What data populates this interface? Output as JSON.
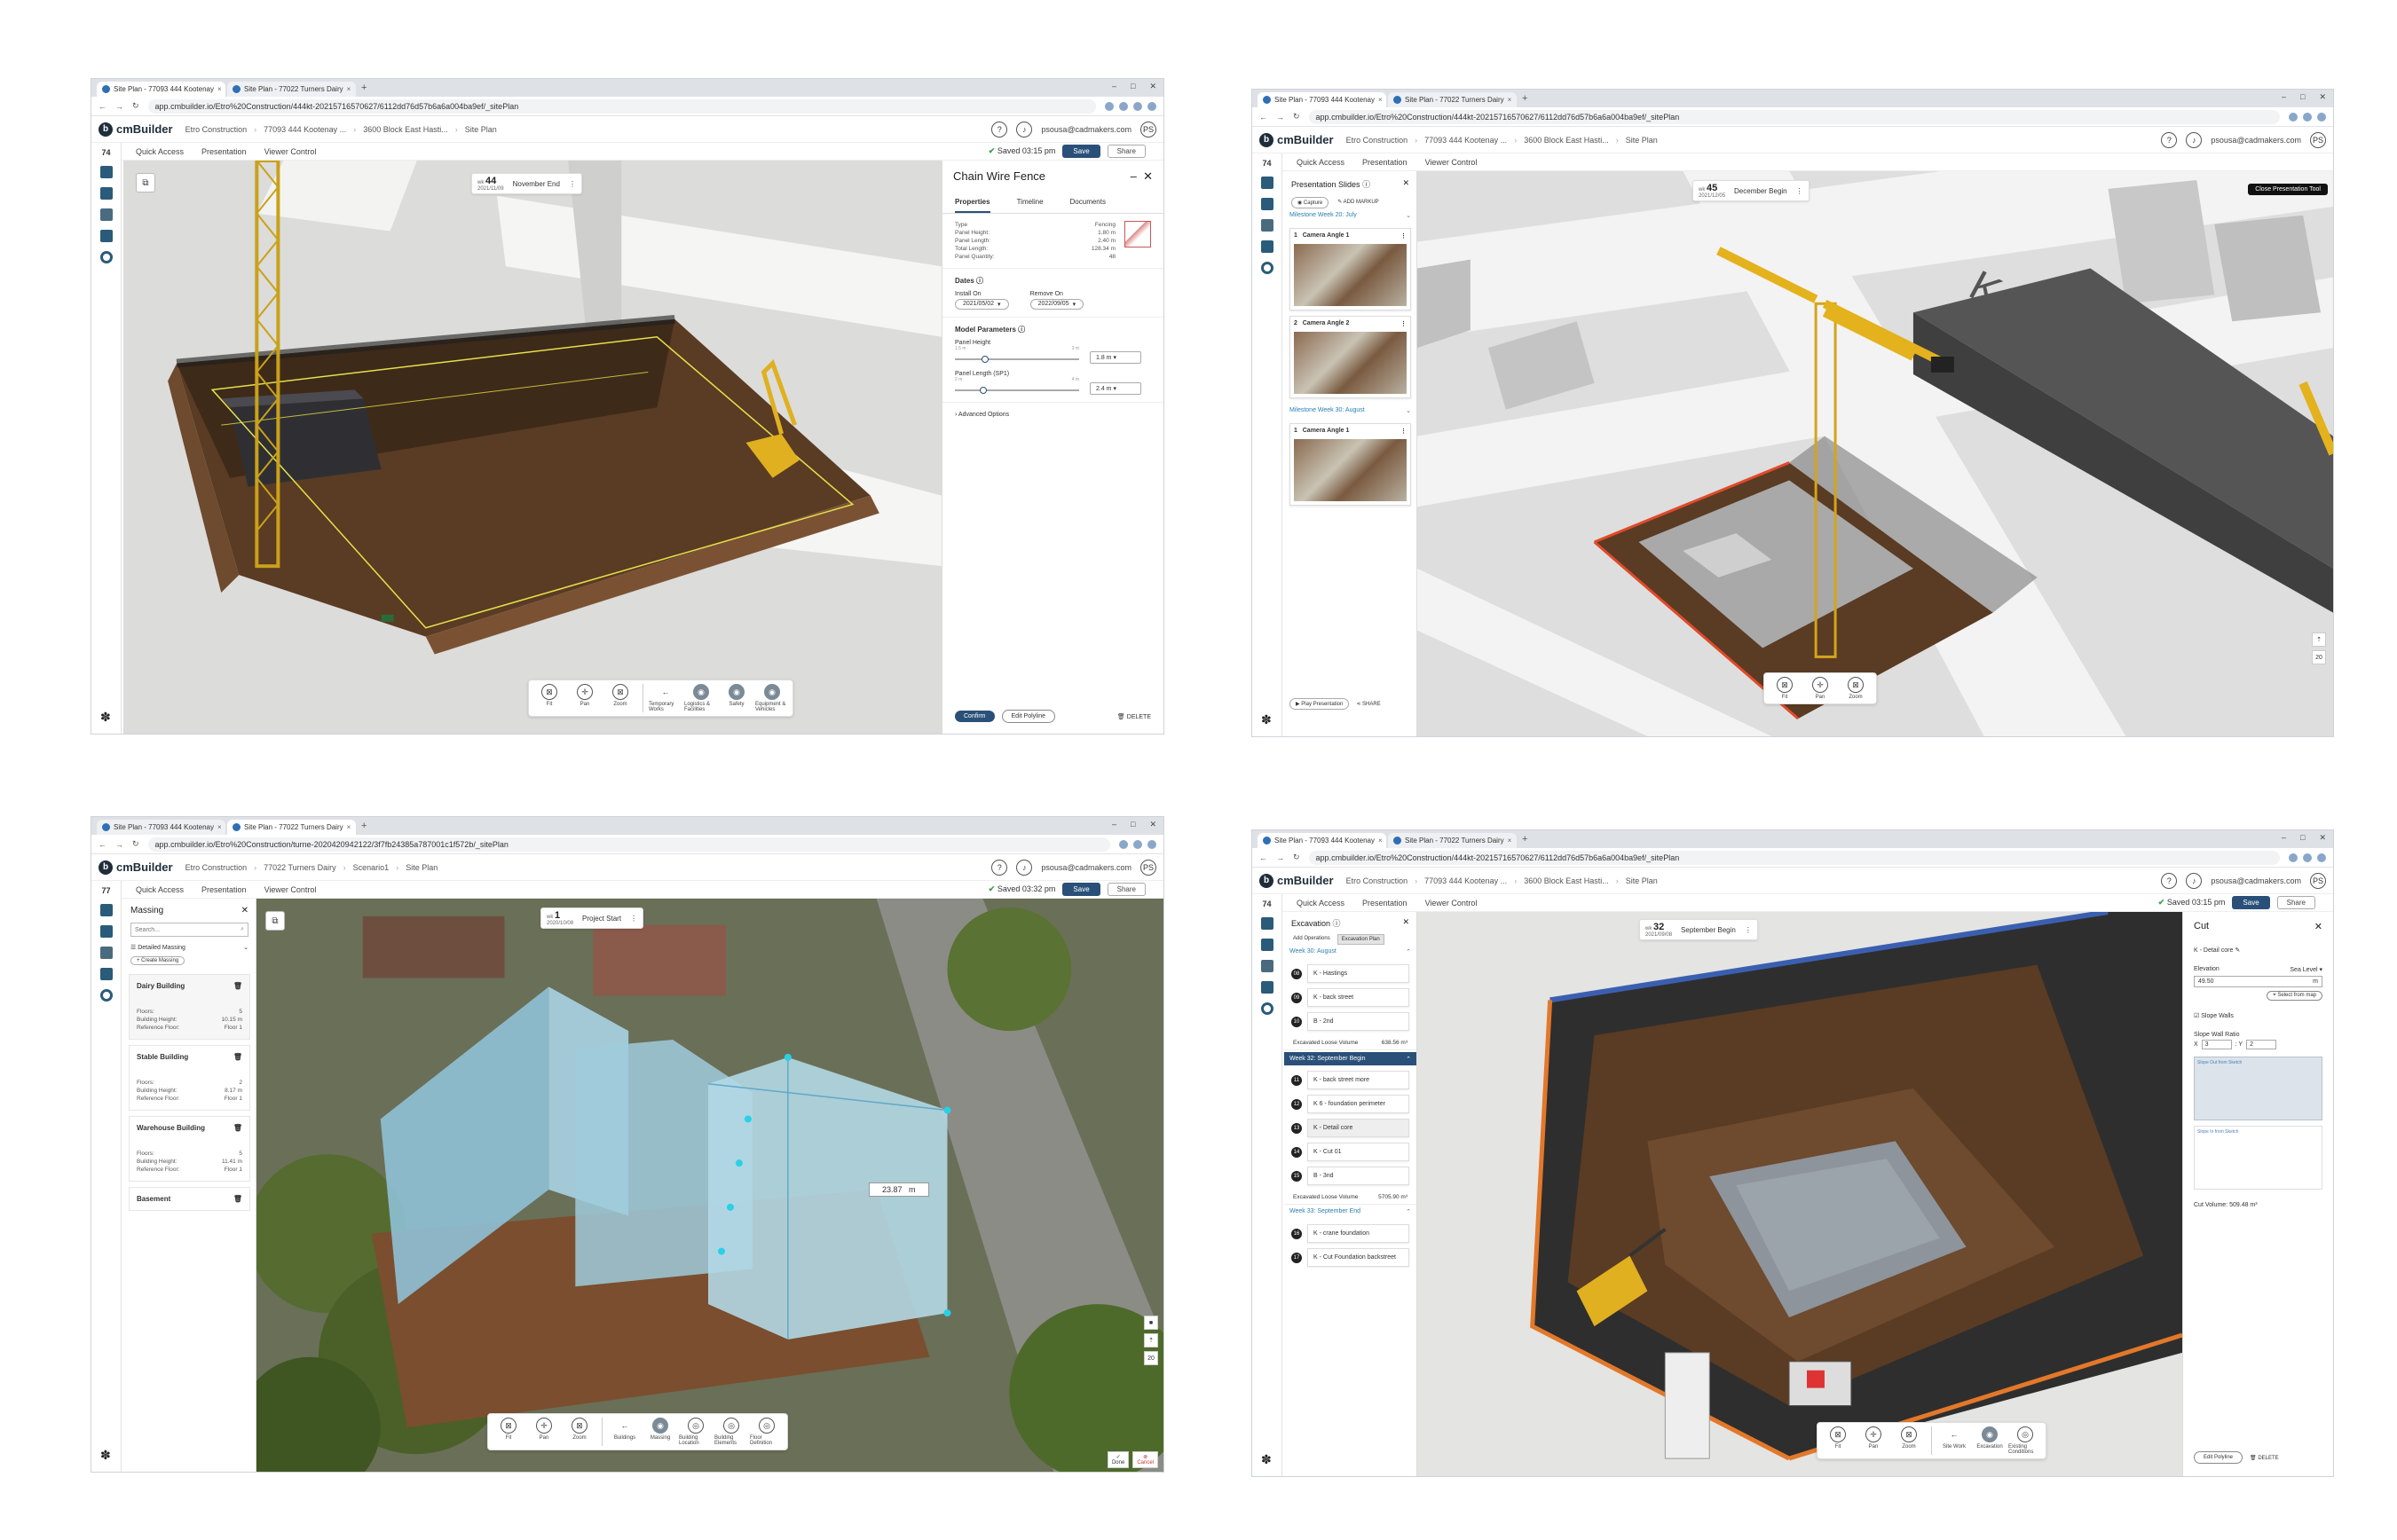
{
  "browser": {
    "tab1": "Site Plan - 77093 444 Kootenay",
    "tab2": "Site Plan - 77022 Turners Dairy",
    "url_a": "app.cmbuilder.io/Etro%20Construction/444kt-20215716570627/6112dd76d57b6a6a004ba9ef/_sitePlan",
    "url_b": "app.cmbuilder.io/Etro%20Construction/turne-2020420942122/3f7fb24385a787001c1f572b/_sitePlan"
  },
  "app": {
    "brand": "cmBuilder",
    "user_email": "psousa@cadmakers.com",
    "user_initials": "PS",
    "save_label": "Save",
    "share_label": "Share",
    "toolbar": [
      "Quick Access",
      "Presentation",
      "Viewer Control"
    ]
  },
  "crumbs_a": [
    "Etro Construction",
    "77093 444 Kootenay ...",
    "3600 Block East Hasti...",
    "Site Plan"
  ],
  "crumbs_b": [
    "Etro Construction",
    "77022 Turners Dairy",
    "Scenario1",
    "Site Plan"
  ],
  "view_tools": {
    "fit": "Fit",
    "pan": "Pan",
    "zoom": "Zoom"
  },
  "w1": {
    "rail_num": "74",
    "saved": "Saved 03:15 pm",
    "week_label": "wk",
    "week": "44",
    "week_date": "2021/11/09",
    "week_name": "November End",
    "panel_title": "Chain Wire Fence",
    "tabs": [
      "Properties",
      "Timeline",
      "Documents"
    ],
    "props": [
      {
        "k": "Type",
        "v": "Fencing"
      },
      {
        "k": "Panel Height:",
        "v": "1.80 m"
      },
      {
        "k": "Panel Length:",
        "v": "2.40 m"
      },
      {
        "k": "Total Length:",
        "v": "128.34 m"
      },
      {
        "k": "Panel Quantity:",
        "v": "48"
      }
    ],
    "dates_title": "Dates",
    "install_label": "Install On",
    "install_date": "2021/05/02",
    "remove_label": "Remove On",
    "remove_date": "2022/09/05",
    "model_title": "Model Parameters",
    "panel_height_label": "Panel Height",
    "ph_min": "1.5 m",
    "ph_max": "3 m",
    "ph_value": "1.8 m",
    "panel_length_label": "Panel Length (SP1)",
    "pl_min": "2 m",
    "pl_max": "4 m",
    "pl_value": "2.4 m",
    "advanced": "Advanced Options",
    "confirm": "Confirm",
    "edit_polyline": "Edit Polyline",
    "delete": "DELETE",
    "tools_extra": [
      "Temporary Works",
      "Logistics & Facilities",
      "Safety",
      "Equipment & Vehicles"
    ]
  },
  "w2": {
    "rail_num": "74",
    "week_label": "wk",
    "week": "45",
    "week_date": "2021/12/05",
    "week_name": "December Begin",
    "panel_title": "Presentation Slides",
    "capture": "Capture",
    "add_markup": "ADD MARKUP",
    "milestone1": "Milestone Week 20: July",
    "milestone2": "Milestone Week 30: August",
    "slides": [
      {
        "num": "1",
        "title": "Camera Angle 1"
      },
      {
        "num": "2",
        "title": "Camera Angle 2"
      },
      {
        "num": "1",
        "title": "Camera Angle 1"
      }
    ],
    "play": "Play Presentation",
    "share": "SHARE",
    "close_tool": "Close Presentation Tool",
    "street": "Kootenay St",
    "zoom_level": "20"
  },
  "w3": {
    "rail_num": "77",
    "saved": "Saved 03:32 pm",
    "week_label": "wk",
    "week": "1",
    "week_date": "2020/10/08",
    "week_name": "Project Start",
    "panel_title": "Massing",
    "search_placeholder": "Search...",
    "group": "Detailed Massing",
    "create": "+ Create Massing",
    "buildings": [
      {
        "name": "Dairy Building",
        "floors": "5",
        "height": "10.15 m",
        "ref": "Floor 1"
      },
      {
        "name": "Stable Building",
        "floors": "2",
        "height": "8.17 m",
        "ref": "Floor 1"
      },
      {
        "name": "Warehouse Building",
        "floors": "5",
        "height": "11.41 m",
        "ref": "Floor 1"
      },
      {
        "name": "Basement",
        "floors": "",
        "height": "",
        "ref": ""
      }
    ],
    "floors_label": "Floors:",
    "height_label": "Building Height:",
    "ref_label": "Reference Floor:",
    "dim": "23.87",
    "dim_unit": "m",
    "tools_extra": [
      "Buildings",
      "Massing",
      "Building Location",
      "Building Elements",
      "Floor Definition"
    ],
    "done": "Done",
    "cancel": "Cancel",
    "zoom_level": "20"
  },
  "w4": {
    "rail_num": "74",
    "saved": "Saved 03:15 pm",
    "week_label": "wk",
    "week": "32",
    "week_date": "2021/09/08",
    "week_name": "September Begin",
    "panel_title": "Excavation",
    "tabs": [
      "Add Operations",
      "Excavation Plan"
    ],
    "week_a": "Week 30: August",
    "week_b": "Week 32: September Begin",
    "week_c": "Week 33: September End",
    "ops_a": [
      {
        "n": "08",
        "t": "K - Hastings"
      },
      {
        "n": "09",
        "t": "K - back street"
      },
      {
        "n": "10",
        "t": "B - 2nd"
      }
    ],
    "vol_a_label": "Excavated Loose Volume",
    "vol_a": "638.56 m³",
    "ops_b": [
      {
        "n": "11",
        "t": "K - back street more"
      },
      {
        "n": "12",
        "t": "K 6 - foundation perimeter"
      },
      {
        "n": "13",
        "t": "K - Detail core"
      },
      {
        "n": "14",
        "t": "K - Cut 01"
      },
      {
        "n": "15",
        "t": "B - 3nd"
      }
    ],
    "vol_b_label": "Excavated Loose Volume",
    "vol_b": "5705.90 m³",
    "ops_c": [
      {
        "n": "16",
        "t": "K - crane foundation"
      },
      {
        "n": "17",
        "t": "K - Cut Foundation backstreet"
      }
    ],
    "cut_title": "Cut",
    "cut_name": "K - Detail core",
    "elevation_label": "Elevation",
    "sea_level": "Sea Level",
    "elevation": "49.50",
    "elev_unit": "m",
    "select_map": "Select from map",
    "slope_walls": "Slope Walls",
    "ratio_label": "Slope Wall Ratio",
    "ratio_x": "3",
    "ratio_y": "2",
    "slope_out": "Slope Out from Sketch",
    "slope_in": "Slope In from Sketch",
    "cut_volume": "Cut Volume: 509.48 m³",
    "edit_polyline": "Edit Polyline",
    "delete": "DELETE",
    "tools_extra": [
      "Site Work",
      "Excavation",
      "Existing Conditions"
    ]
  }
}
